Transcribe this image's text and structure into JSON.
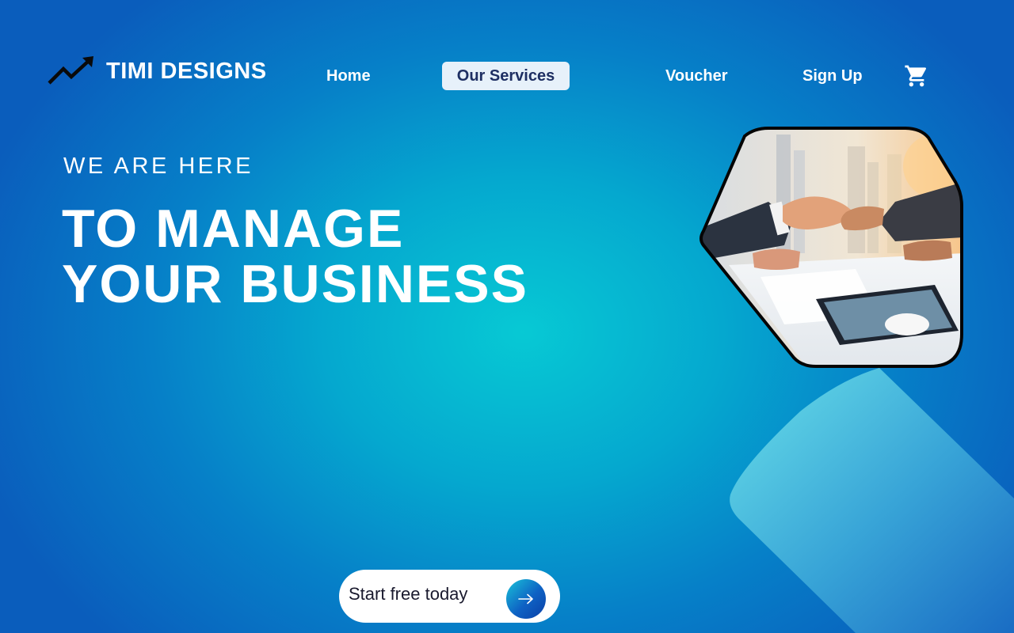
{
  "brand": {
    "name": "TIMI DESIGNS",
    "logo_icon": "trending-up-icon"
  },
  "nav": {
    "items": [
      {
        "label": "Home",
        "active": false
      },
      {
        "label": "Our Services",
        "active": true
      },
      {
        "label": "Voucher",
        "active": false
      },
      {
        "label": "Sign Up",
        "active": false
      }
    ],
    "cart_icon": "shopping-cart-icon"
  },
  "hero": {
    "eyebrow": "WE ARE HERE",
    "headline_line1": "TO MANAGE",
    "headline_line2": "YOUR BUSINESS",
    "image": "business-handshake-photo"
  },
  "cta": {
    "label": "Start free today",
    "icon": "arrow-right-icon"
  },
  "colors": {
    "background_center": "#07c9d4",
    "background_edge": "#0a5dbc",
    "active_nav_bg": "#e7f1fa",
    "active_nav_text": "#1e2f63",
    "text": "#ffffff"
  }
}
